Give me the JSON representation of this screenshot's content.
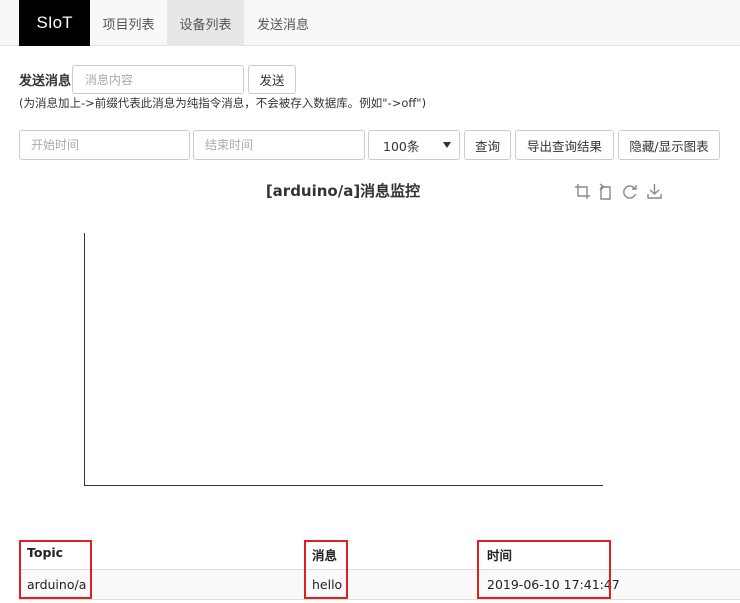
{
  "nav": {
    "brand": "SIoT",
    "items": [
      "项目列表",
      "设备列表",
      "发送消息"
    ],
    "active_index": 1
  },
  "send": {
    "label": "发送消息",
    "input_placeholder": "消息内容",
    "button": "发送",
    "hint": "(为消息加上->前缀代表此消息为纯指令消息，不会被存入数据库。例如\"->off\")"
  },
  "query": {
    "start_placeholder": "开始时间",
    "end_placeholder": "结束时间",
    "limit_selected": "100条",
    "query_button": "查询",
    "export_button": "导出查询结果",
    "toggle_chart_button": "隐藏/显示图表"
  },
  "chart_data": {
    "type": "line",
    "title": "[arduino/a]消息监控",
    "series": [],
    "toolbox_icons": [
      "zoom-icon",
      "zoom-reset-icon",
      "restore-icon",
      "download-icon"
    ]
  },
  "table": {
    "columns": [
      "Topic",
      "消息",
      "时间"
    ],
    "rows": [
      [
        "arduino/a",
        "hello",
        "2019-06-10 17:41:47"
      ]
    ],
    "highlight_color": "#e02020"
  }
}
